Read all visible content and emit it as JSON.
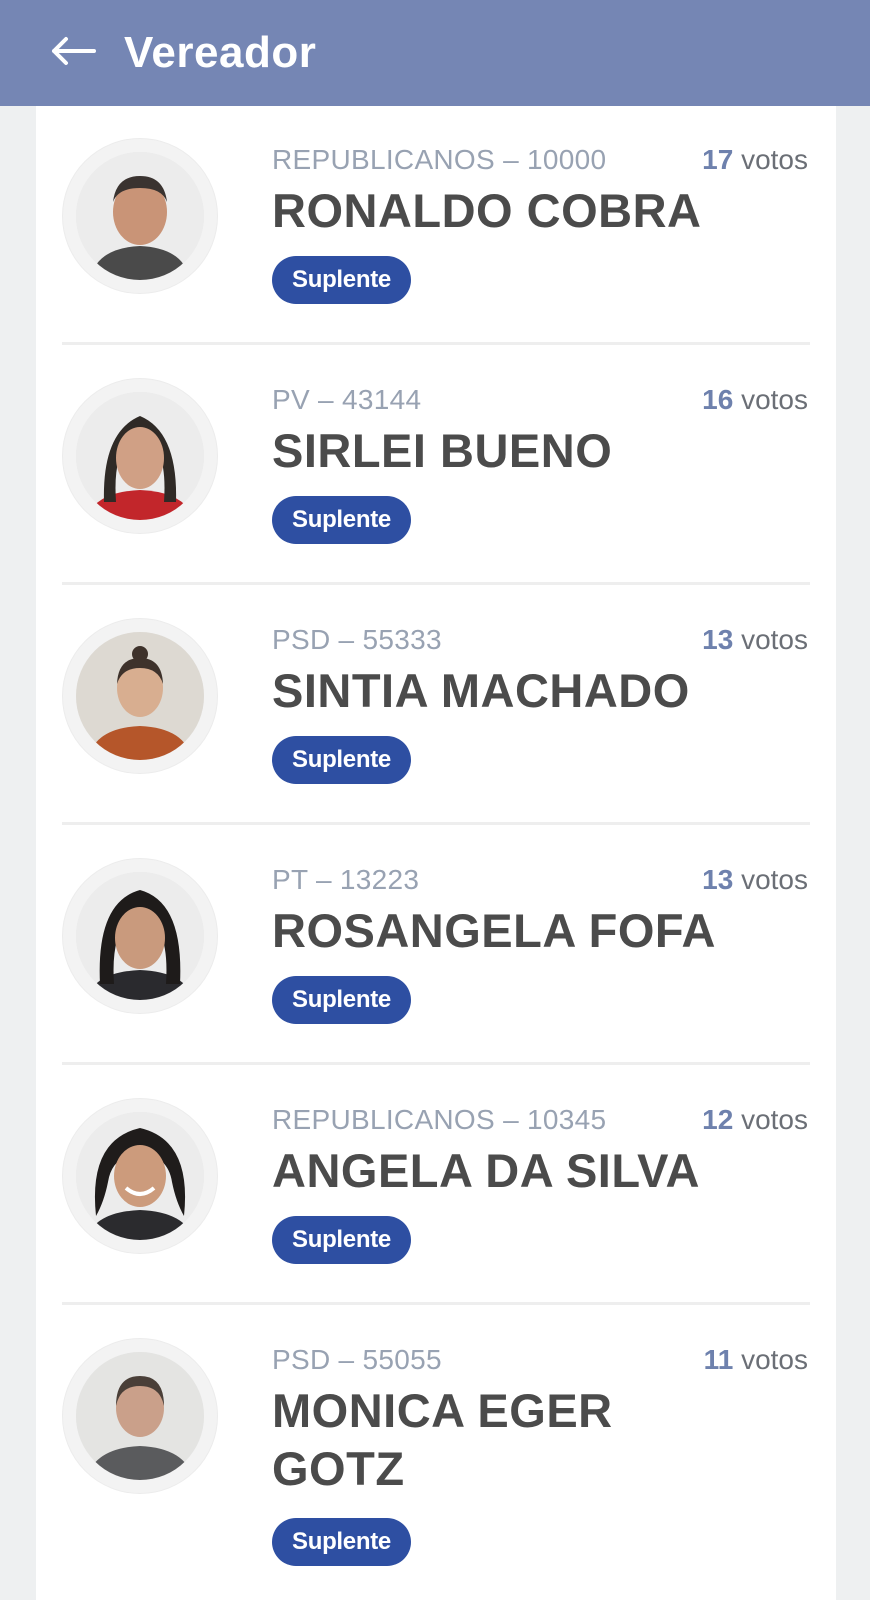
{
  "header": {
    "title": "Vereador",
    "back_icon": "arrow-left-icon",
    "background_color": "#7586b4"
  },
  "colors": {
    "badge": "#2e4fa2",
    "votes_number": "#6e81ad",
    "name": "#4b4b4b",
    "party": "#98a2b2"
  },
  "candidates": [
    {
      "party": "REPUBLICANOS – 10000",
      "name": "RONALDO COBRA",
      "votes_number": "17",
      "votes_word": "votos",
      "status": "Suplente"
    },
    {
      "party": "PV – 43144",
      "name": "SIRLEI BUENO",
      "votes_number": "16",
      "votes_word": "votos",
      "status": "Suplente"
    },
    {
      "party": "PSD – 55333",
      "name": "SINTIA MACHADO",
      "votes_number": "13",
      "votes_word": "votos",
      "status": "Suplente"
    },
    {
      "party": "PT – 13223",
      "name": "ROSANGELA FOFA",
      "votes_number": "13",
      "votes_word": "votos",
      "status": "Suplente"
    },
    {
      "party": "REPUBLICANOS – 10345",
      "name": "ANGELA DA SILVA",
      "votes_number": "12",
      "votes_word": "votos",
      "status": "Suplente"
    },
    {
      "party": "PSD – 55055",
      "name": "MONICA EGER GOTZ",
      "votes_number": "11",
      "votes_word": "votos",
      "status": "Suplente"
    }
  ]
}
